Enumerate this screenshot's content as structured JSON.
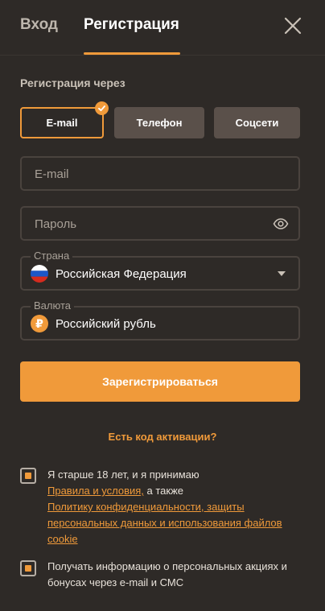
{
  "tabs": {
    "login": "Вход",
    "register": "Регистрация"
  },
  "registration": {
    "section_title": "Регистрация через",
    "methods": {
      "email": "E-mail",
      "phone": "Телефон",
      "social": "Соцсети"
    },
    "selected_method": "E-mail"
  },
  "form": {
    "email_placeholder": "E-mail",
    "password_placeholder": "Пароль",
    "country_label": "Страна",
    "country_value": "Российская Федерация",
    "currency_label": "Валюта",
    "currency_value": "Российский рубль",
    "currency_symbol": "₽",
    "submit_label": "Зарегистрироваться",
    "activation_link": "Есть код активации?"
  },
  "consents": {
    "age_text_before": "Я старше 18 лет, и я принимаю",
    "rules_link": "Правила и условия,",
    "also_text": " а также",
    "privacy_link": "Политику конфиденциальности, защиты персональных данных и использования файлов cookie",
    "age_checked": true,
    "promo_text": "Получать информацию о персональных акциях и бонусах через e-mail и СМС",
    "promo_checked": true
  },
  "colors": {
    "accent": "#f09a3a",
    "background": "#2e2a27",
    "button_secondary": "#5a504a"
  },
  "icons": [
    "close-icon",
    "check-icon",
    "eye-icon",
    "russia-flag-icon",
    "ruble-icon",
    "chevron-down-icon"
  ]
}
